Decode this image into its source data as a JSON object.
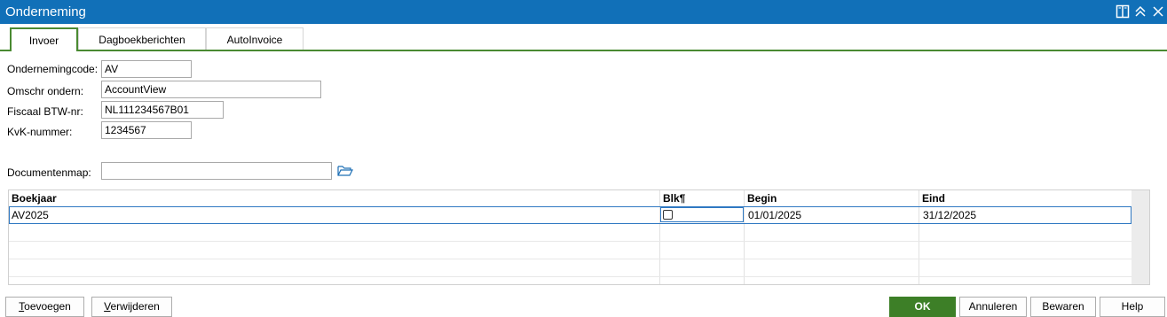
{
  "window": {
    "title": "Onderneming"
  },
  "tabs": [
    {
      "label": "Invoer",
      "active": true
    },
    {
      "label": "Dagboekberichten",
      "active": false
    },
    {
      "label": "AutoInvoice",
      "active": false
    }
  ],
  "form": {
    "code_label": "Ondernemingcode:",
    "code_value": "AV",
    "name_label": "Omschr ondern:",
    "name_value": "AccountView",
    "vat_label": "Fiscaal BTW-nr:",
    "vat_value": "NL111234567B01",
    "kvk_label": "KvK-nummer:",
    "kvk_value": "1234567",
    "docmap_label": "Documentenmap:",
    "docmap_value": ""
  },
  "grid": {
    "columns": [
      "Boekjaar",
      "Blk¶",
      "Begin",
      "Eind"
    ],
    "rows": [
      {
        "boekjaar": "AV2025",
        "blk": false,
        "begin": "01/01/2025",
        "eind": "31/12/2025"
      }
    ]
  },
  "buttons": {
    "add_first": "T",
    "add_rest": "oevoegen",
    "delete_first": "V",
    "delete_rest": "erwijderen",
    "ok": "OK",
    "cancel": "Annuleren",
    "save": "Bewaren",
    "help": "Help"
  },
  "colors": {
    "titlebar": "#1170b8",
    "accent_green": "#4a8a32",
    "selection_blue": "#2f78c2"
  },
  "icons": [
    "split-view-icon",
    "collapse-icon",
    "close-icon",
    "folder-open-icon"
  ]
}
